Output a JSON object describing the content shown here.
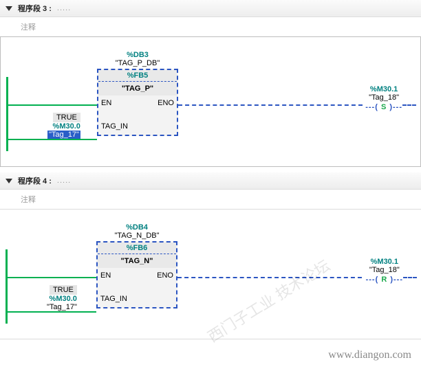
{
  "networks": [
    {
      "title": "程序段 3 :",
      "comment": "注释",
      "block": {
        "db_addr": "%DB3",
        "db_name": "\"TAG_P_DB\"",
        "fb_type": "%FB5",
        "fb_label": "\"TAG_P\"",
        "en": "EN",
        "eno": "ENO",
        "tag_in": "TAG_IN"
      },
      "input": {
        "true_label": "TRUE",
        "addr": "%M30.0",
        "tag": "\"Tag_17\"",
        "selected": true
      },
      "coil": {
        "addr": "%M30.1",
        "tag": "\"Tag_18\"",
        "letter": "S"
      }
    },
    {
      "title": "程序段 4 :",
      "comment": "注释",
      "block": {
        "db_addr": "%DB4",
        "db_name": "\"TAG_N_DB\"",
        "fb_type": "%FB6",
        "fb_label": "\"TAG_N\"",
        "en": "EN",
        "eno": "ENO",
        "tag_in": "TAG_IN"
      },
      "input": {
        "true_label": "TRUE",
        "addr": "%M30.0",
        "tag": "\"Tag_17\"",
        "selected": false
      },
      "coil": {
        "addr": "%M30.1",
        "tag": "\"Tag_18\"",
        "letter": "R"
      }
    }
  ],
  "watermark": "西门子工业 技术论坛",
  "footer": "www.diangon.com"
}
